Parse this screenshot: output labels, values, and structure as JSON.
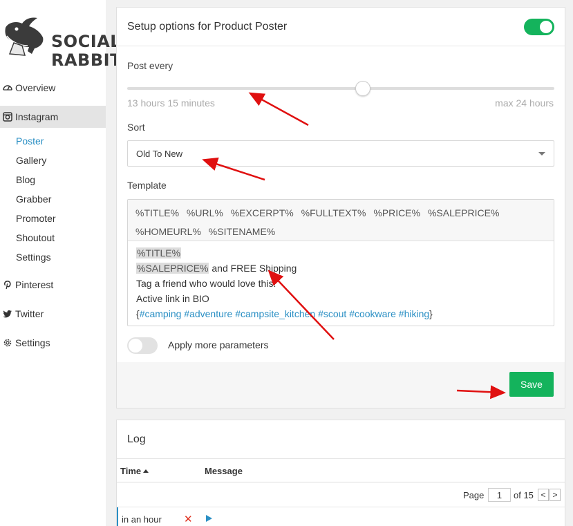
{
  "brand": {
    "line1": "SOCIAL",
    "line2": "RABBIT"
  },
  "sidebar": {
    "items": [
      {
        "label": "Overview",
        "icon": "dashboard-icon"
      },
      {
        "label": "Instagram",
        "icon": "instagram-icon"
      },
      {
        "label": "Pinterest",
        "icon": "pinterest-icon"
      },
      {
        "label": "Twitter",
        "icon": "twitter-icon"
      },
      {
        "label": "Settings",
        "icon": "gear-icon"
      }
    ],
    "instagram_sub": [
      "Poster",
      "Gallery",
      "Blog",
      "Grabber",
      "Promoter",
      "Shoutout",
      "Settings"
    ]
  },
  "setup": {
    "title": "Setup options for Product Poster",
    "enabled": true,
    "post_every_label": "Post every",
    "slider_value_text": "13 hours 15 minutes",
    "slider_max_text": "max 24 hours",
    "slider_fraction": 0.552,
    "sort_label": "Sort",
    "sort_value": "Old To New",
    "template_label": "Template",
    "tags": [
      "%TITLE%",
      "%URL%",
      "%EXCERPT%",
      "%FULLTEXT%",
      "%PRICE%",
      "%SALEPRICE%",
      "%HOMEURL%",
      "%SITENAME%"
    ],
    "body": {
      "line1_tag": "%TITLE%",
      "line2_tag": "%SALEPRICE%",
      "line2_rest": " and FREE Shipping",
      "line3": "Tag a friend who would love this!",
      "line4": "Active link in BIO",
      "line5_open": "{",
      "line5_tags": "#camping #adventure #campsite_kitchen #scout #cookware #hiking",
      "line5_close": "}"
    },
    "more_params_label": "Apply more parameters",
    "more_params_enabled": false,
    "save_label": "Save"
  },
  "log": {
    "title": "Log",
    "col_time": "Time",
    "col_message": "Message",
    "page_label": "Page",
    "page_value": "1",
    "of_label": "of 15",
    "prev": "<",
    "next": ">",
    "rows": [
      {
        "time": "in an hour"
      }
    ]
  },
  "colors": {
    "accent": "#14b35c",
    "link": "#2a8fc4",
    "arrow": "#e01010"
  }
}
